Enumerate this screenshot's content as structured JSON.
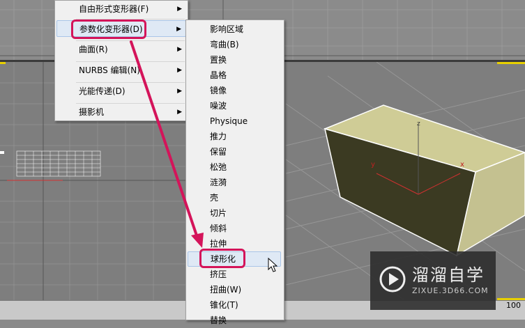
{
  "submenu_parent": {
    "items": [
      {
        "label": "自由形式变形器(F)"
      },
      {
        "label": "参数化变形器(D)"
      },
      {
        "label": "曲面(R)"
      },
      {
        "label": "NURBS 编辑(N)"
      },
      {
        "label": "光能传递(D)"
      },
      {
        "label": "摄影机"
      }
    ],
    "highlighted": "参数化变形器(D)"
  },
  "modifier_menu": {
    "items": [
      {
        "label": "影响区域"
      },
      {
        "label": "弯曲(B)"
      },
      {
        "label": "置换"
      },
      {
        "label": "晶格"
      },
      {
        "label": "镜像"
      },
      {
        "label": "噪波"
      },
      {
        "label": "Physique"
      },
      {
        "label": "推力"
      },
      {
        "label": "保留"
      },
      {
        "label": "松弛"
      },
      {
        "label": "涟漪"
      },
      {
        "label": "壳"
      },
      {
        "label": "切片"
      },
      {
        "label": "倾斜"
      },
      {
        "label": "拉伸"
      },
      {
        "label": "球形化"
      },
      {
        "label": "挤压"
      },
      {
        "label": "扭曲(W)"
      },
      {
        "label": "锥化(T)"
      },
      {
        "label": "替换"
      }
    ],
    "highlighted": "球形化"
  },
  "viewport": {
    "axis_x": "x",
    "axis_y": "y",
    "axis_z": "z",
    "frame_number": "100"
  },
  "watermark": {
    "title": "溜溜自学",
    "subtitle": "ZIXUE.3D66.COM"
  },
  "colors": {
    "highlight": "#d4145a",
    "box_top": "#cfcc96",
    "box_front": "#3b3a22"
  }
}
